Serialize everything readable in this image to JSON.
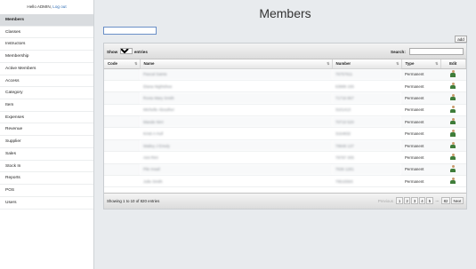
{
  "sidebar": {
    "greeting": "Hello ADMIN,",
    "logout": "Log out",
    "items": [
      {
        "label": "Members",
        "active": true
      },
      {
        "label": "Classes"
      },
      {
        "label": "Instructors"
      },
      {
        "label": "Membership"
      },
      {
        "label": "Active Members"
      },
      {
        "label": "Access"
      },
      {
        "label": "Category"
      },
      {
        "label": "Item"
      },
      {
        "label": "Expenses"
      },
      {
        "label": "Revenue"
      },
      {
        "label": "Supplier"
      },
      {
        "label": "Sales"
      },
      {
        "label": "Stock In"
      },
      {
        "label": "Reports"
      },
      {
        "label": "POS"
      },
      {
        "label": "Users"
      }
    ]
  },
  "page": {
    "title": "Members"
  },
  "toolbar": {
    "add_label": "add"
  },
  "table": {
    "show_label": "Show",
    "entries_value": "10",
    "entries_label": "entries",
    "search_label": "Search:",
    "columns": [
      "Code",
      "Name",
      "Number",
      "Type",
      "Edit"
    ],
    "rows": [
      {
        "code": "",
        "name": "Pascal Saints",
        "number": "76757611",
        "type": "Permanent",
        "edit_icon": "user-edit-icon"
      },
      {
        "code": "",
        "name": "Diana Nightshee",
        "number": "63989 155",
        "type": "Permanent",
        "edit_icon": "user-edit-icon"
      },
      {
        "code": "",
        "name": "Rovia Mary Smith",
        "number": "71716 867",
        "type": "Permanent",
        "edit_icon": "user-edit-icon"
      },
      {
        "code": "",
        "name": "Michelle Abouther",
        "number": "3101413",
        "type": "Permanent",
        "edit_icon": "user-edit-icon"
      },
      {
        "code": "",
        "name": "Mande Nirri",
        "number": "70710 520",
        "type": "Permanent",
        "edit_icon": "user-edit-icon"
      },
      {
        "code": "",
        "name": "Kristi A Hull",
        "number": "3164832",
        "type": "Permanent",
        "edit_icon": "user-edit-icon"
      },
      {
        "code": "",
        "name": "Wailey J Emely",
        "number": "79949 137",
        "type": "Permanent",
        "edit_icon": "user-edit-icon"
      },
      {
        "code": "",
        "name": "Aint Rirri",
        "number": "79797 305",
        "type": "Permanent",
        "edit_icon": "user-edit-icon"
      },
      {
        "code": "",
        "name": "Pile Insail",
        "number": "7636 1281",
        "type": "Permanent",
        "edit_icon": "user-edit-icon"
      },
      {
        "code": "",
        "name": "Julie Smith",
        "number": "79515593",
        "type": "Permanent",
        "edit_icon": "user-edit-icon"
      }
    ],
    "info": "Showing 1 to 10 of 820 entries",
    "pager": {
      "previous": "Previous",
      "pages": [
        "1",
        "2",
        "3",
        "4",
        "5"
      ],
      "ellipsis": "…",
      "last": "82",
      "next": "Next"
    }
  },
  "colors": {
    "background": "#e8ebee",
    "sidebar": "#ffffff",
    "active_item": "#d9dcdf",
    "link": "#2f6db5"
  }
}
